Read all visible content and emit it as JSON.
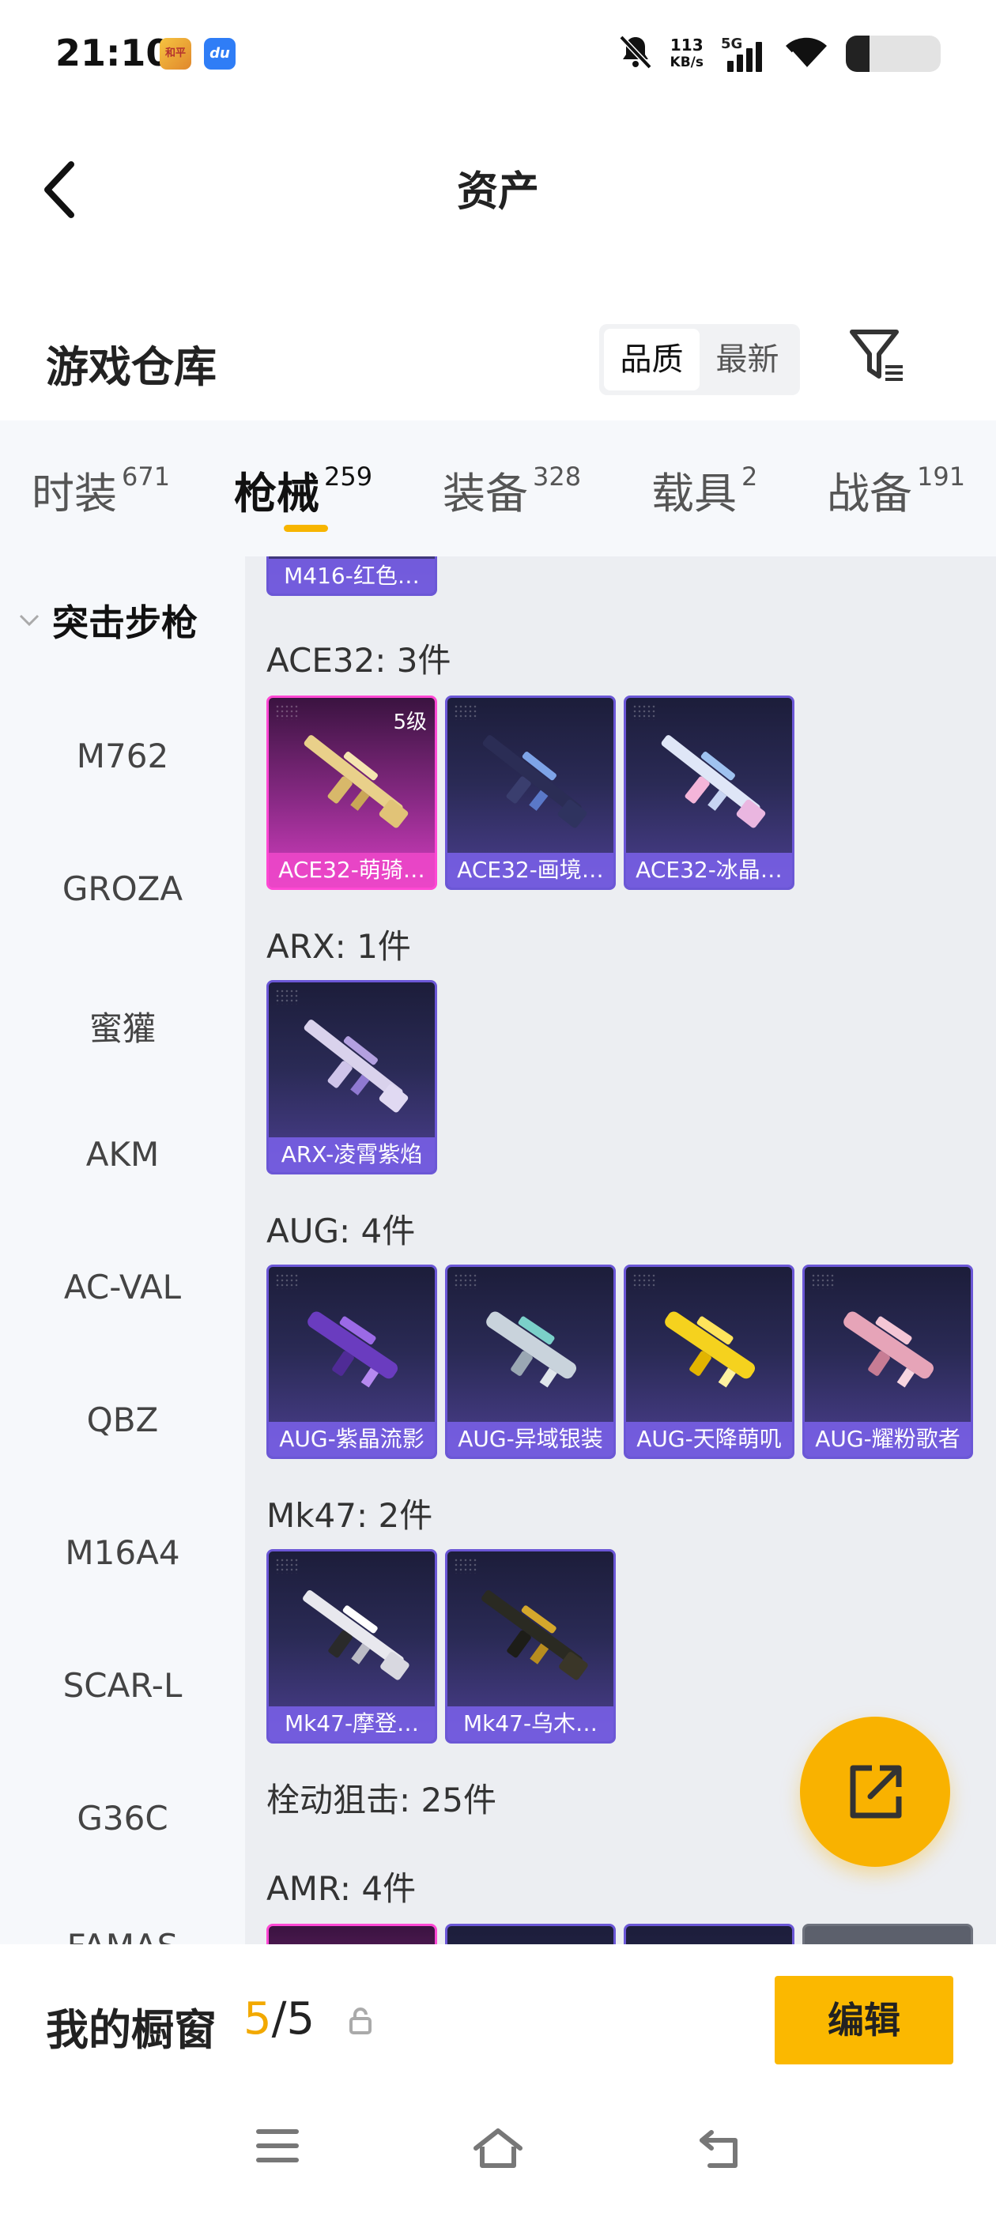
{
  "status_bar": {
    "time": "21:10",
    "app_icon_1": "game-center-icon",
    "app_icon_2": "du",
    "net_speed_value": "113",
    "net_speed_unit": "KB/s",
    "network": "5G"
  },
  "header": {
    "title": "资产"
  },
  "warehouse": {
    "title": "游戏仓库",
    "sort_options": [
      "品质",
      "最新"
    ],
    "sort_selected": "品质"
  },
  "tabs": [
    {
      "label": "时装",
      "count": "671"
    },
    {
      "label": "枪械",
      "count": "259",
      "active": true
    },
    {
      "label": "装备",
      "count": "328"
    },
    {
      "label": "载具",
      "count": "2"
    },
    {
      "label": "战备",
      "count": "191"
    }
  ],
  "side_nav": {
    "category": "突击步枪",
    "items": [
      "M762",
      "GROZA",
      "蜜獾",
      "AKM",
      "AC-VAL",
      "QBZ",
      "M16A4",
      "SCAR-L",
      "G36C",
      "FAMAS"
    ]
  },
  "content": {
    "top_partial_card": "M416-红色…",
    "groups": [
      {
        "title": "ACE32: 3件",
        "items": [
          {
            "label": "ACE32-萌骑…",
            "level": "5级",
            "rarity": "pink"
          },
          {
            "label": "ACE32-画境…",
            "rarity": "purple"
          },
          {
            "label": "ACE32-冰晶…",
            "rarity": "purple"
          }
        ]
      },
      {
        "title": "ARX: 1件",
        "items": [
          {
            "label": "ARX-凌霄紫焰",
            "rarity": "purple"
          }
        ]
      },
      {
        "title": "AUG: 4件",
        "items": [
          {
            "label": "AUG-紫晶流影",
            "rarity": "purple"
          },
          {
            "label": "AUG-异域银装",
            "rarity": "purple"
          },
          {
            "label": "AUG-天降萌叽",
            "rarity": "purple"
          },
          {
            "label": "AUG-耀粉歌者",
            "rarity": "purple"
          }
        ]
      },
      {
        "title": "Mk47: 2件",
        "items": [
          {
            "label": "Mk47-摩登…",
            "rarity": "purple"
          },
          {
            "label": "Mk47-乌木…",
            "rarity": "purple"
          }
        ]
      }
    ],
    "sniper_section": "栓动狙击: 25件",
    "amr_title": "AMR: 4件"
  },
  "showcase": {
    "title": "我的橱窗",
    "current": "5",
    "separator": "/",
    "total": "5",
    "edit_label": "编辑"
  },
  "colors": {
    "accent": "#f9b200",
    "card_purple": "#6b57d6",
    "card_pink": "#ff48d4",
    "tab_bg": "#f6f8fb",
    "content_bg": "#eceef2"
  }
}
